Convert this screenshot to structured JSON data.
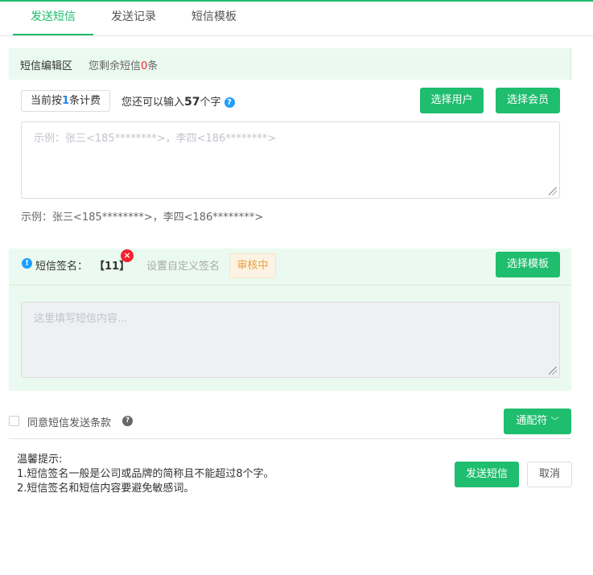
{
  "tabs": [
    {
      "label": "发送短信",
      "active": true
    },
    {
      "label": "发送记录",
      "active": false
    },
    {
      "label": "短信模板",
      "active": false
    }
  ],
  "editor": {
    "title": "短信编辑区",
    "remain_prefix": "您剩余短信",
    "remain_count": "0",
    "remain_suffix": "条"
  },
  "billing": {
    "prefix": "当前按",
    "count": "1",
    "suffix": "条计费"
  },
  "char_info": {
    "prefix": "您还可以输入",
    "count": "57",
    "suffix": "个字"
  },
  "buttons": {
    "select_user": "选择用户",
    "select_member": "选择会员",
    "select_template": "选择模板",
    "wildcard": "通配符",
    "send": "发送短信",
    "cancel": "取消"
  },
  "recipients": {
    "placeholder": "示例：张三<185********>，李四<186********>",
    "example": "示例：张三<185********>，李四<186********>"
  },
  "signature": {
    "label": "短信签名：",
    "value": "【11】",
    "custom_label": "设置自定义签名",
    "status": "审核中"
  },
  "content": {
    "placeholder": "这里填写短信内容..."
  },
  "agree": {
    "label": "同意短信发送条款"
  },
  "tips": {
    "title": "温馨提示:",
    "line1": "1.短信签名一般是公司或品牌的简称且不能超过8个字。",
    "line2": "2.短信签名和短信内容要避免敏感词。"
  },
  "colors": {
    "primary": "#1fbd6e",
    "section_bg": "#eafaf0",
    "danger": "#f5222d",
    "warning": "#e6a23c",
    "info": "#1e9fff"
  }
}
